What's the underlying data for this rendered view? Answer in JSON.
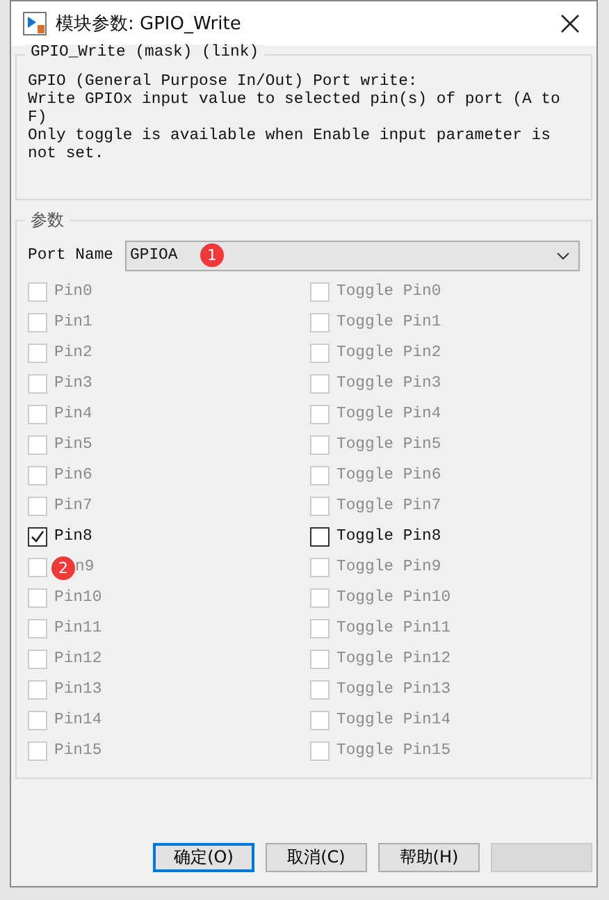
{
  "window": {
    "title": "模块参数: GPIO_Write"
  },
  "description": {
    "title": "GPIO_Write (mask) (link)",
    "lines": [
      "GPIO (General Purpose In/Out) Port write:",
      "Write GPIOx input value to selected pin(s) of port (A to",
      "F)",
      "Only toggle is available when Enable input parameter is",
      "not set."
    ]
  },
  "parameters": {
    "title": "参数",
    "port_name": {
      "label": "Port Name",
      "value": "GPIOA"
    },
    "pins": [
      {
        "label": "Pin0",
        "checked": false,
        "disabled": true
      },
      {
        "label": "Pin1",
        "checked": false,
        "disabled": true
      },
      {
        "label": "Pin2",
        "checked": false,
        "disabled": true
      },
      {
        "label": "Pin3",
        "checked": false,
        "disabled": true
      },
      {
        "label": "Pin4",
        "checked": false,
        "disabled": true
      },
      {
        "label": "Pin5",
        "checked": false,
        "disabled": true
      },
      {
        "label": "Pin6",
        "checked": false,
        "disabled": true
      },
      {
        "label": "Pin7",
        "checked": false,
        "disabled": true
      },
      {
        "label": "Pin8",
        "checked": true,
        "disabled": false
      },
      {
        "label": "n9",
        "checked": false,
        "disabled": true,
        "annotation": "2"
      },
      {
        "label": "Pin10",
        "checked": false,
        "disabled": true
      },
      {
        "label": "Pin11",
        "checked": false,
        "disabled": true
      },
      {
        "label": "Pin12",
        "checked": false,
        "disabled": true
      },
      {
        "label": "Pin13",
        "checked": false,
        "disabled": true
      },
      {
        "label": "Pin14",
        "checked": false,
        "disabled": true
      },
      {
        "label": "Pin15",
        "checked": false,
        "disabled": true
      }
    ],
    "toggles": [
      {
        "label": "Toggle Pin0",
        "checked": false,
        "disabled": true
      },
      {
        "label": "Toggle Pin1",
        "checked": false,
        "disabled": true
      },
      {
        "label": "Toggle Pin2",
        "checked": false,
        "disabled": true
      },
      {
        "label": "Toggle Pin3",
        "checked": false,
        "disabled": true
      },
      {
        "label": "Toggle Pin4",
        "checked": false,
        "disabled": true
      },
      {
        "label": "Toggle Pin5",
        "checked": false,
        "disabled": true
      },
      {
        "label": "Toggle Pin6",
        "checked": false,
        "disabled": true
      },
      {
        "label": "Toggle Pin7",
        "checked": false,
        "disabled": true
      },
      {
        "label": "Toggle Pin8",
        "checked": false,
        "disabled": false
      },
      {
        "label": "Toggle Pin9",
        "checked": false,
        "disabled": true
      },
      {
        "label": "Toggle Pin10",
        "checked": false,
        "disabled": true
      },
      {
        "label": "Toggle Pin11",
        "checked": false,
        "disabled": true
      },
      {
        "label": "Toggle Pin12",
        "checked": false,
        "disabled": true
      },
      {
        "label": "Toggle Pin13",
        "checked": false,
        "disabled": true
      },
      {
        "label": "Toggle Pin14",
        "checked": false,
        "disabled": true
      },
      {
        "label": "Toggle Pin15",
        "checked": false,
        "disabled": true
      }
    ]
  },
  "annotations": [
    "1"
  ],
  "buttons": [
    {
      "label": "确定(O)",
      "selected": true,
      "disabled": false
    },
    {
      "label": "取消(C)",
      "selected": false,
      "disabled": false
    },
    {
      "label": "帮助(H)",
      "selected": false,
      "disabled": false
    },
    {
      "selected": false,
      "disabled": true
    }
  ]
}
